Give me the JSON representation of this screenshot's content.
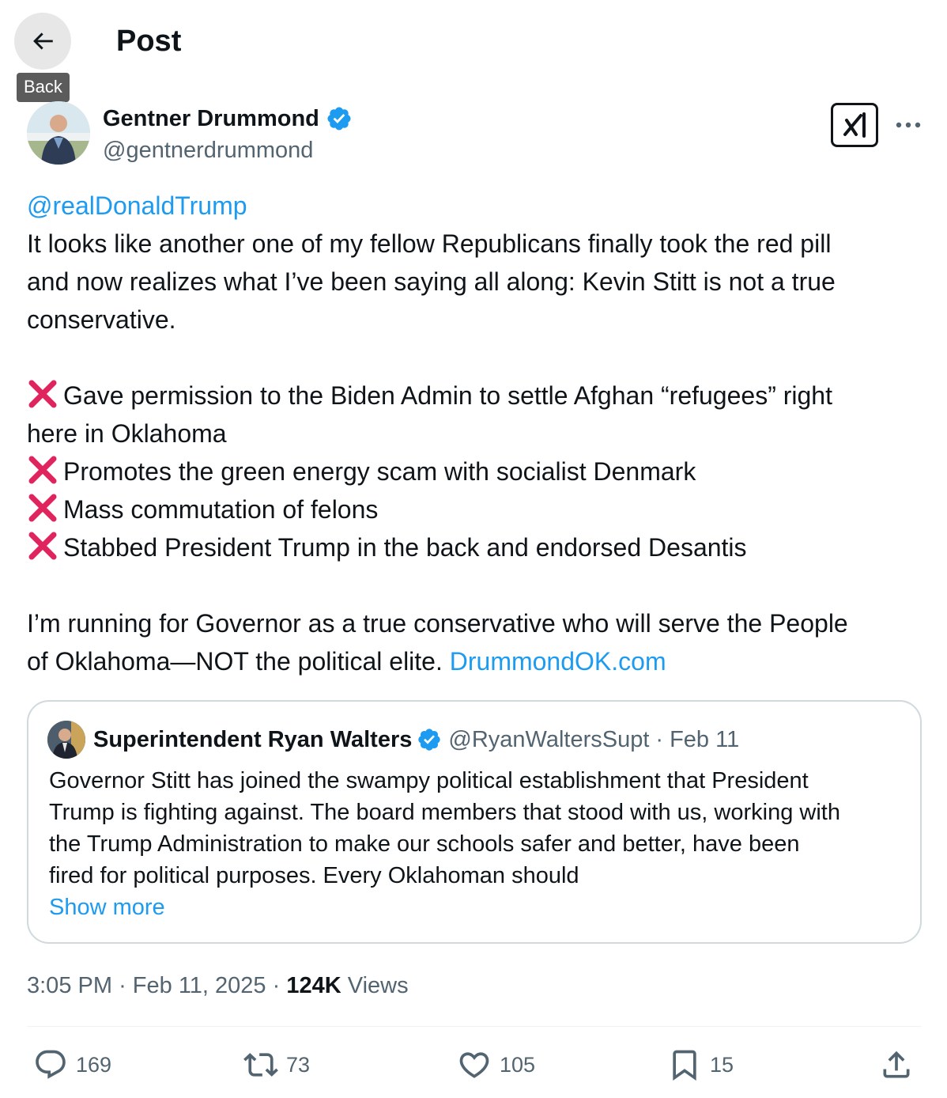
{
  "header": {
    "title": "Post",
    "back_tooltip": "Back"
  },
  "author": {
    "name": "Gentner Drummond",
    "handle": "@gentnerdrummond",
    "verified_color": "#1d9bf0"
  },
  "tweet": {
    "mention": "@realDonaldTrump",
    "intro_lines": [
      "It looks like another one of my fellow Republicans finally took the red pill",
      "and now realizes what I’ve been saying all along: Kevin Stitt is not a true",
      "conservative."
    ],
    "bullet_1a": "Gave permission to the Biden Admin to settle Afghan “refugees” right",
    "bullet_1b": "here in Oklahoma",
    "bullet_2": "Promotes the green energy scam with socialist Denmark",
    "bullet_3": "Mass commutation of felons",
    "bullet_4": "Stabbed President Trump in the back and endorsed Desantis",
    "closing_1": "I’m running for Governor as a true conservative who will serve the People",
    "closing_2": "of Oklahoma—NOT the political elite.",
    "link": "DrummondOK.com"
  },
  "quote": {
    "name": "Superintendent Ryan Walters",
    "handle": "@RyanWaltersSupt",
    "sep": "·",
    "date": "Feb 11",
    "lines": [
      "Governor Stitt has joined the swampy political establishment that President",
      "Trump is fighting against. The board members that stood with us, working with",
      "the Trump Administration to make our schools safer and better, have been",
      "fired for political purposes. Every Oklahoman should"
    ],
    "show_more": "Show more"
  },
  "meta": {
    "time": "3:05 PM",
    "sep": "·",
    "date": "Feb 11, 2025",
    "views_count": "124K",
    "views_label": "Views"
  },
  "actions": {
    "replies": "169",
    "reposts": "73",
    "likes": "105",
    "bookmarks": "15"
  },
  "colors": {
    "accent": "#1d9bf0",
    "muted": "#536471",
    "text": "#0f1419",
    "x_mark": "#e0245e"
  },
  "icons": [
    "back-arrow-icon",
    "verified-badge-icon",
    "grok-icon",
    "more-icon",
    "x-mark-icon",
    "reply-icon",
    "repost-icon",
    "like-icon",
    "bookmark-icon",
    "share-icon"
  ]
}
